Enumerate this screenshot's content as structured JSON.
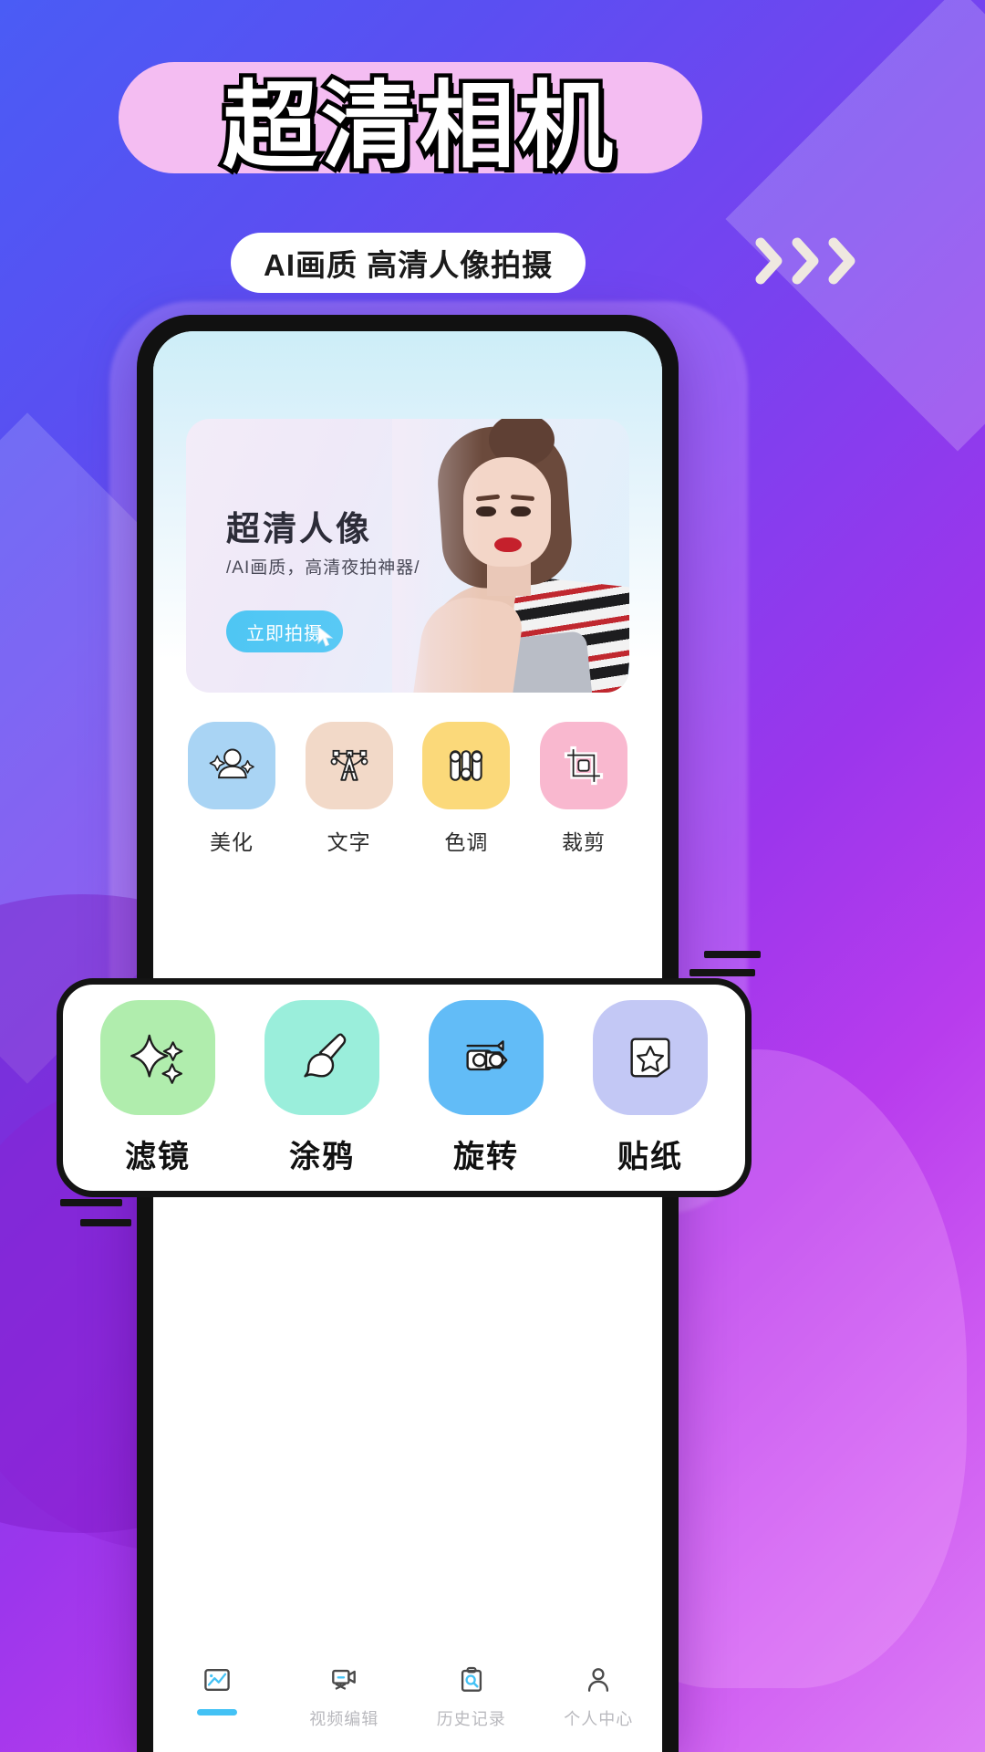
{
  "header": {
    "title": "超清相机",
    "subtitle": "AI画质 高清人像拍摄",
    "arrows_icon": "chevron-right-triple-icon"
  },
  "phone": {
    "hero": {
      "title": "超清人像",
      "subtitle": "/AI画质，高清夜拍神器/",
      "cta_label": "立即拍摄",
      "cta_cursor_icon": "cursor-pointer-icon",
      "photo_alt": "portrait-model-photo"
    },
    "features": [
      {
        "label": "美化",
        "icon": "beautify-person-sparkle-icon",
        "color": "#a9d4f4"
      },
      {
        "label": "文字",
        "icon": "text-pen-tool-icon",
        "color": "#f2d9c8"
      },
      {
        "label": "色调",
        "icon": "color-sliders-icon",
        "color": "#fbd97a"
      },
      {
        "label": "裁剪",
        "icon": "crop-icon",
        "color": "#f9b8cf"
      }
    ],
    "tabs": [
      {
        "label": "",
        "icon": "photo-chart-icon",
        "active": true
      },
      {
        "label": "视频编辑",
        "icon": "video-camera-icon",
        "active": false
      },
      {
        "label": "历史记录",
        "icon": "clipboard-search-icon",
        "active": false
      },
      {
        "label": "个人中心",
        "icon": "user-profile-icon",
        "active": false
      }
    ]
  },
  "overlay": {
    "items": [
      {
        "label": "滤镜",
        "icon": "sparkle-filter-icon",
        "color": "#b0edad"
      },
      {
        "label": "涂鸦",
        "icon": "paint-brush-icon",
        "color": "#9aeedb"
      },
      {
        "label": "旋转",
        "icon": "rotate-camera-icon",
        "color": "#62bcf7"
      },
      {
        "label": "贴纸",
        "icon": "star-sticker-icon",
        "color": "#c3c8f5"
      }
    ]
  },
  "colors": {
    "accent_blue": "#44c2f5",
    "banner_pink": "#f4bdf2",
    "bg_purple": "#7b3df0"
  }
}
